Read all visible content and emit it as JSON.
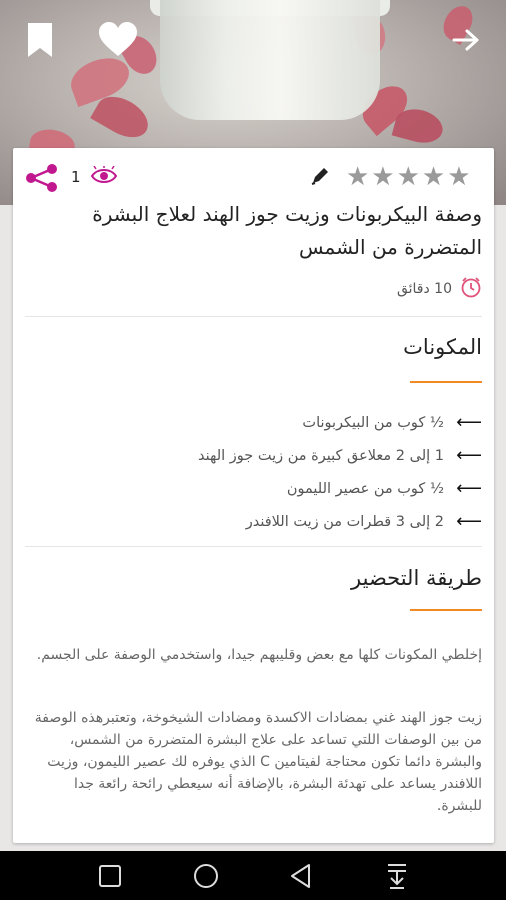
{
  "hero": {
    "icons": [
      "bookmark-icon",
      "heart-icon",
      "arrow-forward-icon"
    ]
  },
  "recipe": {
    "views": "1",
    "rating_stars": "★★★★★",
    "title": "وصفة البيكربونات وزيت جوز الهند لعلاج البشرة المتضررة من الشمس",
    "time": "10 دقائق"
  },
  "ingredients": {
    "heading": "المكونات",
    "items": [
      "½ كوب من البيكربونات",
      "1 إلى 2 معلاعق كبيرة من زيت جوز الهند",
      "½ كوب من عصير الليمون",
      "2 إلى 3 قطرات من زيت اللافندر"
    ]
  },
  "preparation": {
    "heading": "طريقة التحضير",
    "paragraph1": "إخلطي المكونات كلها مع بعض وقليبهم جيدا، واستخدمي الوصفة على الجسم.",
    "paragraph2": "زيت جوز الهند غني بمضادات الاكسدة ومضادات الشيخوخة، وتعتبرهذه الوصفة من بين الوصفات اللتي تساعد على علاج البشرة المتضررة من الشمس، والبشرة دائما تكون محتاجة لفيتامين C الذي يوفره لك عصير الليمون، وزيت اللافندر يساعد على تهدئة البشرة، بالإضافة أنه سيعطي رائحة رائعة جدا للبشرة."
  },
  "colors": {
    "accent_orange": "#f08a24",
    "accent_magenta": "#c2188f",
    "star_gray": "#9a9a9a"
  }
}
